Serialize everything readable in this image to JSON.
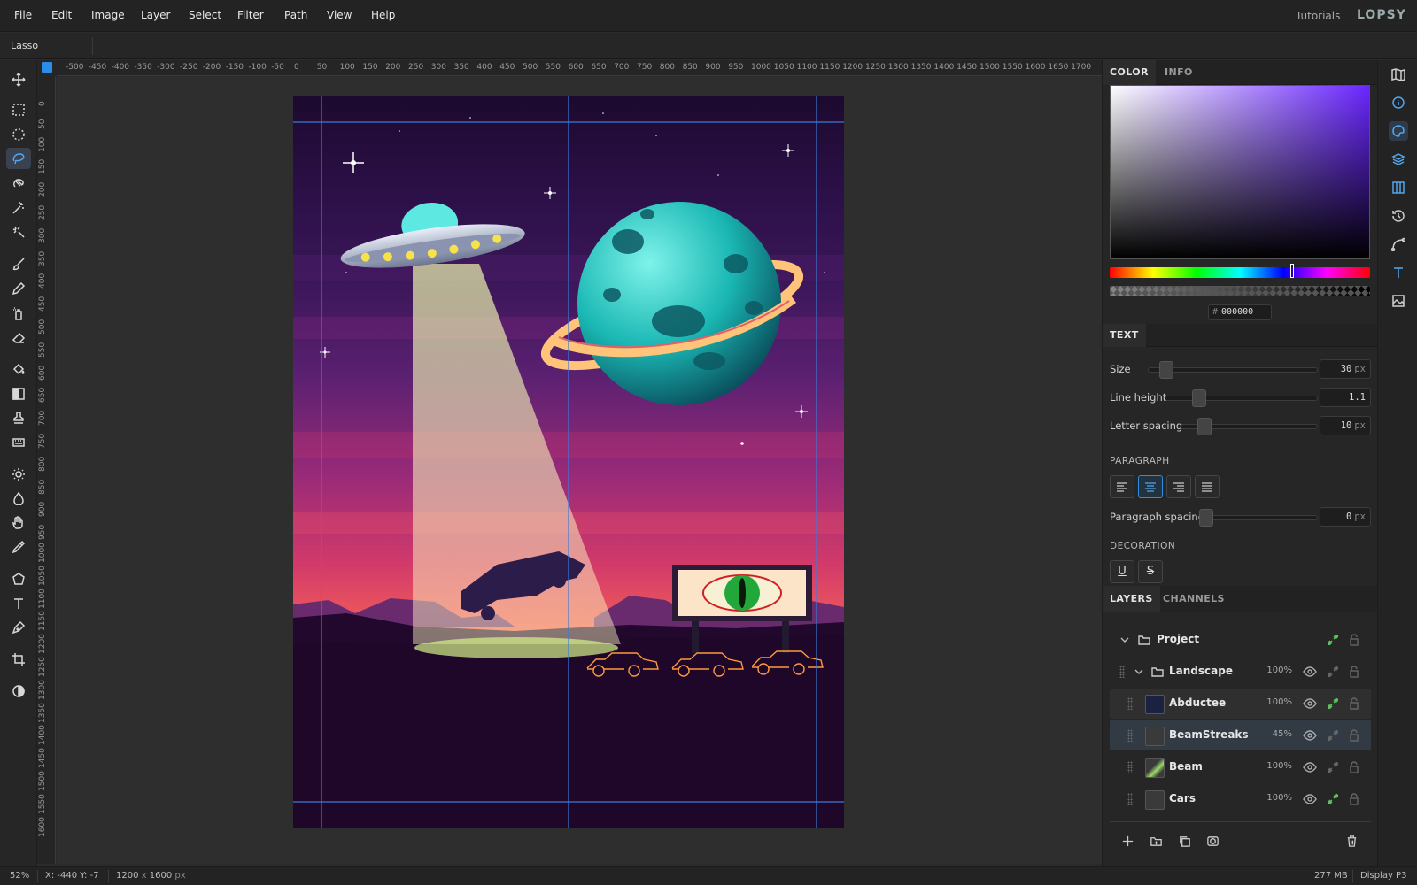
{
  "menu": [
    "File",
    "Edit",
    "Image",
    "Layer",
    "Select",
    "Filter",
    "Path",
    "View",
    "Help"
  ],
  "header": {
    "tutorials": "Tutorials",
    "logo": "LOPSY"
  },
  "options": {
    "tool_name": "Lasso"
  },
  "rulers": {
    "h_ticks": [
      "-500",
      "-450",
      "-400",
      "-350",
      "-300",
      "-250",
      "-200",
      "-150",
      "-100",
      "-50",
      "0",
      "50",
      "100",
      "150",
      "200",
      "250",
      "300",
      "350",
      "400",
      "450",
      "500",
      "550",
      "600",
      "650",
      "700",
      "750",
      "800",
      "850",
      "900",
      "950",
      "1000",
      "1050",
      "1100",
      "1150",
      "1200",
      "1250",
      "1300",
      "1350",
      "1400",
      "1450",
      "1500",
      "1550",
      "1600",
      "1650",
      "1700"
    ],
    "v_ticks": [
      "0",
      "50",
      "100",
      "150",
      "200",
      "250",
      "300",
      "350",
      "400",
      "450",
      "500",
      "550",
      "600",
      "650",
      "700",
      "750",
      "800",
      "850",
      "900",
      "950",
      "1000",
      "1050",
      "1100",
      "1150",
      "1200",
      "1250",
      "1300",
      "1350",
      "1400",
      "1450",
      "1500",
      "1550",
      "1600"
    ]
  },
  "color_panel": {
    "tabs": [
      "COLOR",
      "INFO"
    ],
    "hex_hash": "#",
    "hex_value": "000000"
  },
  "text_panel": {
    "title": "TEXT",
    "size_label": "Size",
    "size_value": "30",
    "size_unit": "px",
    "line_height_label": "Line height",
    "line_height_value": "1.1",
    "letter_spacing_label": "Letter spacing",
    "letter_spacing_value": "10",
    "letter_spacing_unit": "px",
    "paragraph_title": "PARAGRAPH",
    "paragraph_spacing_label": "Paragraph spacing",
    "paragraph_spacing_value": "0",
    "paragraph_spacing_unit": "px",
    "decoration_title": "DECORATION",
    "underline": "U",
    "strike": "S"
  },
  "layers_panel": {
    "tabs": [
      "LAYERS",
      "CHANNELS"
    ],
    "rows": [
      {
        "name": "Project",
        "opacity": ""
      },
      {
        "name": "Landscape",
        "opacity": "100%"
      },
      {
        "name": "Abductee",
        "opacity": "100%"
      },
      {
        "name": "BeamStreaks",
        "opacity": "45%"
      },
      {
        "name": "Beam",
        "opacity": "100%"
      },
      {
        "name": "Cars",
        "opacity": "100%"
      }
    ]
  },
  "status": {
    "zoom": "52%",
    "coords": "X: -440  Y: -7",
    "dims_w": "1200",
    "dims_x": "x",
    "dims_h": "1600",
    "dims_unit": "px",
    "memory": "277 MB",
    "profile": "Display P3"
  }
}
